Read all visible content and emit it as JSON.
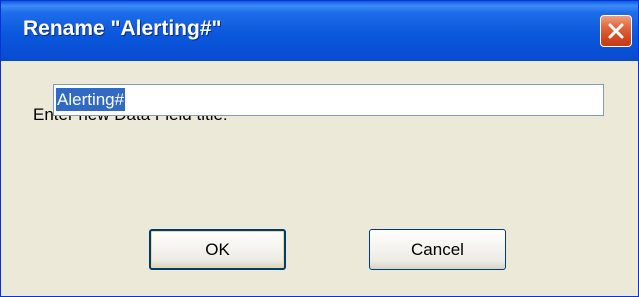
{
  "window": {
    "title": "Rename \"Alerting#\""
  },
  "dialog": {
    "prompt": "Enter new Data Field title:",
    "field_value": "Alerting#",
    "ok_label": "OK",
    "cancel_label": "Cancel"
  },
  "icons": {
    "close": "close-icon"
  },
  "colors": {
    "titlebar": "#0b58dc",
    "close_button": "#d44a20",
    "selection": "#316ac5",
    "dialog_background": "#ece9d8"
  }
}
